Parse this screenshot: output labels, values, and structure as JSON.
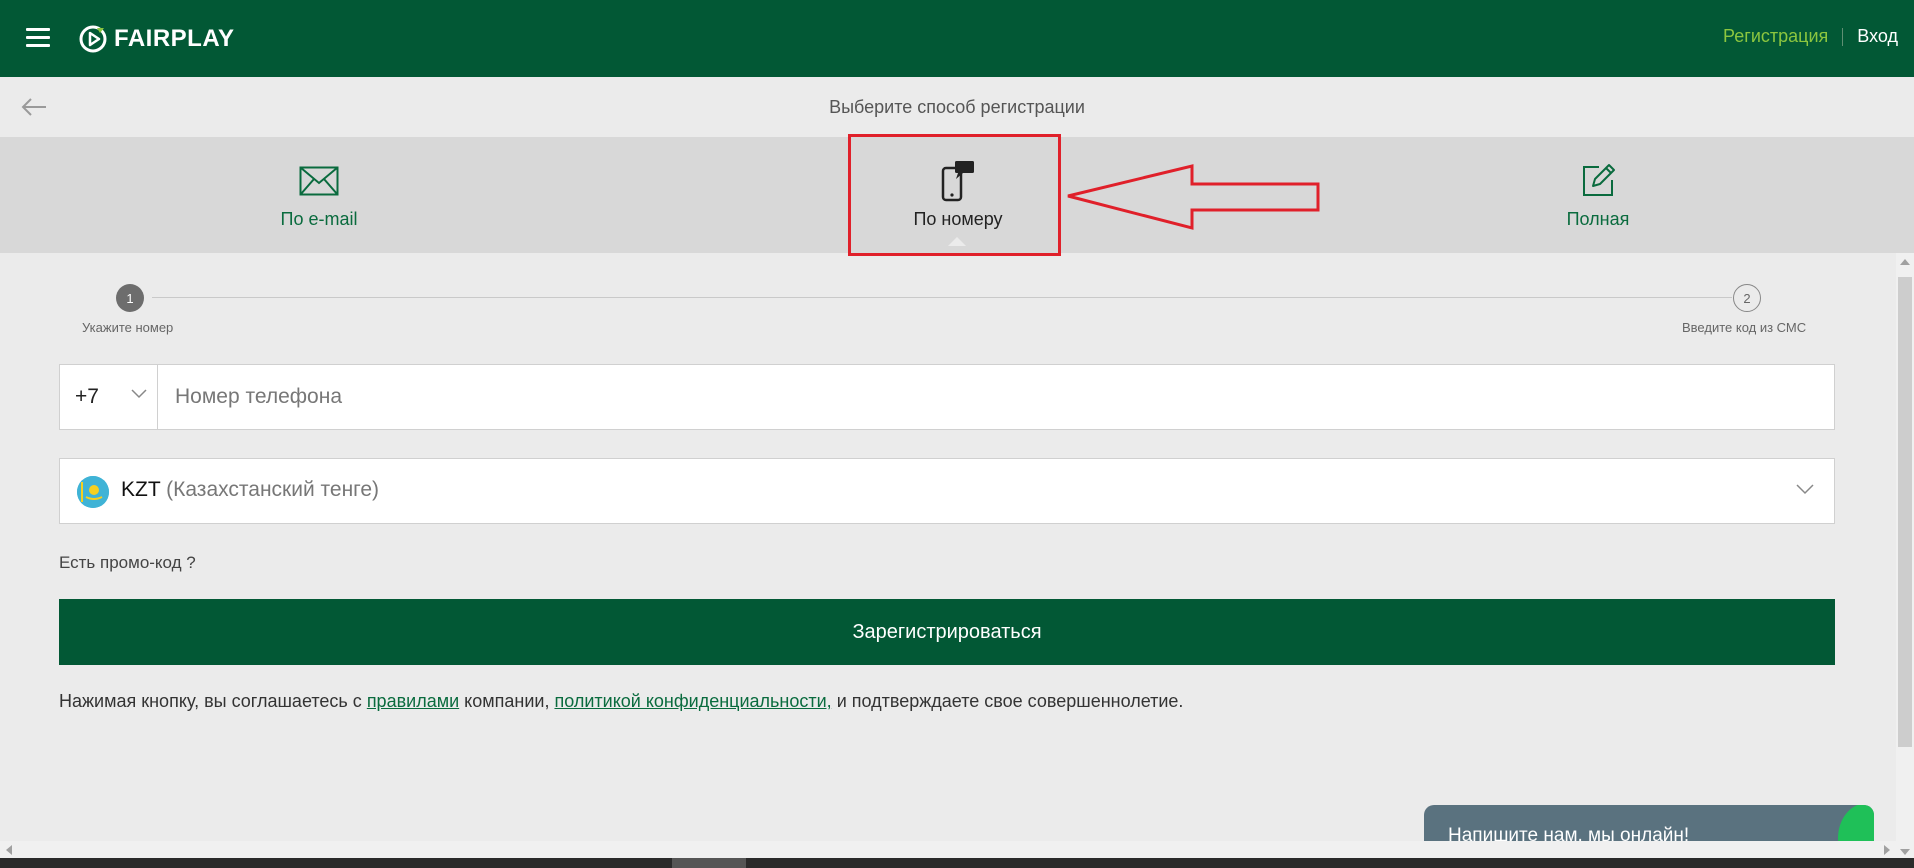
{
  "header": {
    "brand": "FAIRPLAY",
    "register_label": "Регистрация",
    "login_label": "Вход"
  },
  "subheader": {
    "title": "Выберите способ регистрации"
  },
  "tabs": [
    {
      "label": "По e-mail",
      "icon": "envelope-icon"
    },
    {
      "label": "По номеру",
      "icon": "phone-message-icon",
      "active": true
    },
    {
      "label": "Полная",
      "icon": "edit-icon"
    }
  ],
  "stepper": {
    "steps": [
      {
        "number": "1",
        "label": "Укажите номер",
        "active": true
      },
      {
        "number": "2",
        "label": "Введите код из СМС",
        "active": false
      }
    ]
  },
  "form": {
    "country_code": "+7",
    "phone_placeholder": "Номер телефона",
    "currency_code": "KZT",
    "currency_name": "(Казахстанский тенге)",
    "promo_label": "Есть промо-код ?",
    "submit_label": "Зарегистрироваться"
  },
  "agreement": {
    "prefix": "Нажимая кнопку, вы соглашаетесь с",
    "rules_link": "правилами",
    "middle": "компании,",
    "privacy_link": "политикой конфиденциальности,",
    "suffix": "и подтверждаете свое совершеннолетие."
  },
  "chat": {
    "label": "Напишите нам, мы онлайн!"
  },
  "colors": {
    "brand_green": "#025835",
    "accent_lime": "#8cc63f",
    "link_green": "#0a6b3e",
    "annotation_red": "#e0202a",
    "chat_bg": "#5a727f"
  }
}
